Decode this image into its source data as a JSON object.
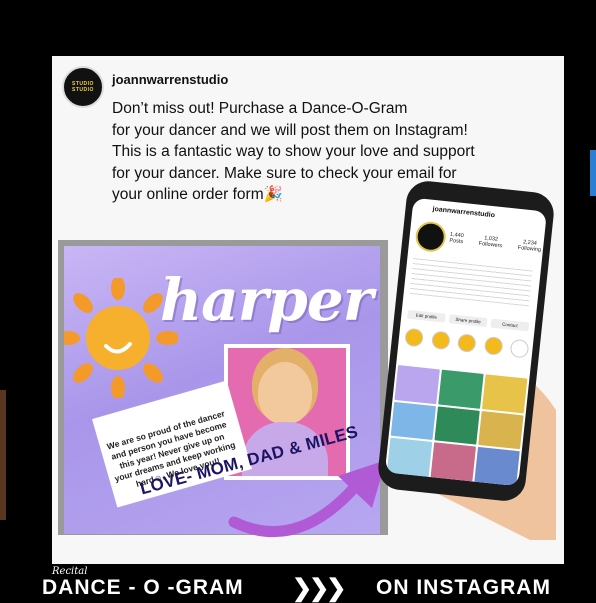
{
  "post": {
    "username": "joannwarrenstudio",
    "avatar_text": [
      "STUDIO",
      "STUDIO"
    ],
    "caption_lines": [
      "Don’t miss out! Purchase a Dance-O-Gram",
      "for your dancer and we will post them on Instagram!",
      "This is a fantastic way to show your love and support",
      "for your dancer. Make sure to check your email for",
      "your online order form🎉"
    ]
  },
  "promo": {
    "dancer_name": "harper",
    "message": "We are so proud of the dancer and person you have become this year! Never give up on your dreams and keep working hard☺. We love you!!",
    "signoff": "LOVE- MOM, DAD & MILES"
  },
  "phone": {
    "username": "joannwarrenstudio",
    "stats": [
      {
        "value": "1,440",
        "label": "Posts"
      },
      {
        "value": "1,032",
        "label": "Followers"
      },
      {
        "value": "2,234",
        "label": "Following"
      }
    ],
    "buttons": [
      "Edit profile",
      "Share profile",
      "Contact"
    ]
  },
  "banner": {
    "script": "Recital",
    "left": "DANCE - O -GRAM",
    "chevrons": "❯❯❯",
    "right": "ON INSTAGRAM"
  },
  "colors": {
    "accent_purple": "#a996ea",
    "sun_orange": "#f49a2a",
    "navy_text": "#1b1464",
    "ig_highlight": "#f4b91c"
  }
}
